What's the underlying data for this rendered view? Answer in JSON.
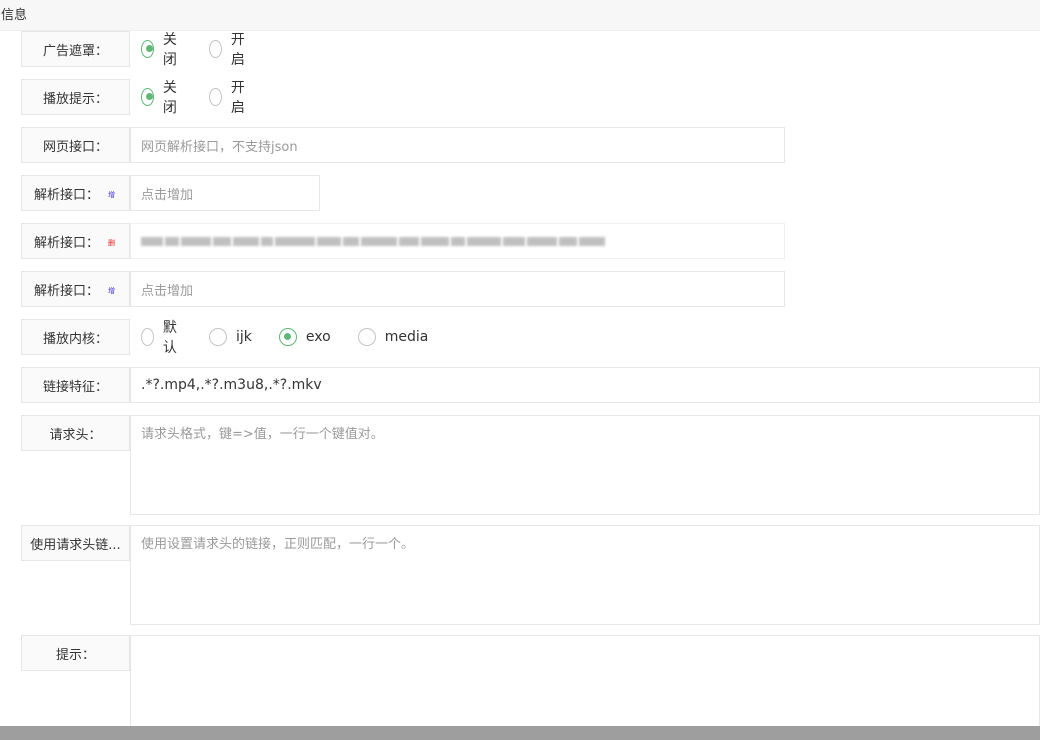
{
  "header": {
    "title": "信息"
  },
  "form": {
    "ad_block": {
      "label": "广告遮罩：",
      "options": [
        "关闭",
        "开启"
      ],
      "selected": "关闭"
    },
    "play_tip": {
      "label": "播放提示：",
      "options": [
        "关闭",
        "开启"
      ],
      "selected": "关闭"
    },
    "web_api": {
      "label": "网页接口：",
      "placeholder": "网页解析接口，不支持json"
    },
    "parse_add_1": {
      "label": "解析接口：",
      "badge": "增",
      "placeholder": "点击增加"
    },
    "parse_existing": {
      "label": "解析接口：",
      "badge": "删",
      "value_note": "blurred"
    },
    "parse_add_2": {
      "label": "解析接口：",
      "badge": "增",
      "placeholder": "点击增加"
    },
    "player_core": {
      "label": "播放内核：",
      "options": [
        "默认",
        "ijk",
        "exo",
        "media"
      ],
      "selected": "exo"
    },
    "link_pattern": {
      "label": "链接特征：",
      "value": ".*?.mp4,.*?.m3u8,.*?.mkv"
    },
    "headers": {
      "label": "请求头：",
      "placeholder": "请求头格式，键=>值，一行一个键值对。"
    },
    "header_links": {
      "label": "使用请求头链...",
      "placeholder": "使用设置请求头的链接，正则匹配，一行一个。"
    },
    "tip": {
      "label": "提示：",
      "value": ""
    }
  },
  "colors": {
    "accent": "#5fb878",
    "add_badge": "#3b2bd6",
    "del_badge": "#e02020"
  }
}
